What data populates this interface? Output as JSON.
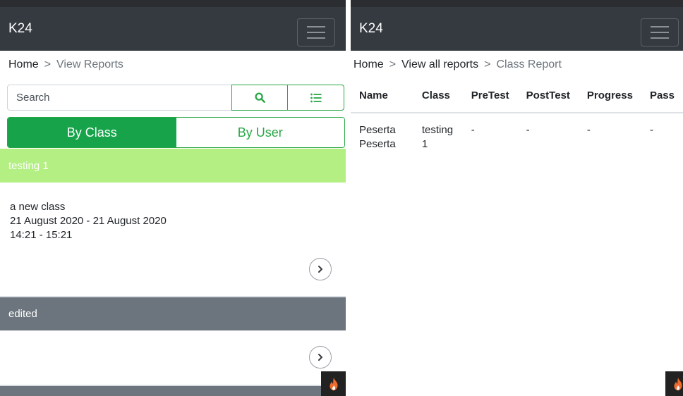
{
  "left": {
    "brand": "K24",
    "breadcrumb": {
      "home": "Home",
      "separator": ">",
      "current": "View Reports"
    },
    "search": {
      "placeholder": "Search"
    },
    "tabs": {
      "by_class": "By Class",
      "by_user": "By User"
    },
    "classes": [
      {
        "title": "testing 1",
        "style": "green",
        "lines": []
      },
      {
        "title": "a new class",
        "style": "none",
        "lines": [
          "a new class",
          "21 August 2020 - 21 August 2020",
          "14:21 - 15:21"
        ]
      },
      {
        "title": "edited",
        "style": "gray",
        "lines": []
      }
    ],
    "colors": {
      "accent": "#28a745",
      "active_tab": "#16a34a",
      "header_green": "#b3ef82",
      "header_gray": "#6c757d"
    }
  },
  "right": {
    "brand": "K24",
    "breadcrumb": {
      "home": "Home",
      "separator": ">",
      "middle": "View all reports",
      "current": "Class Report"
    },
    "table": {
      "headers": [
        "Name",
        "Class",
        "PreTest",
        "PostTest",
        "Progress",
        "Pass"
      ],
      "rows": [
        [
          "Peserta Peserta",
          "testing 1",
          "-",
          "-",
          "-",
          "-"
        ]
      ]
    }
  },
  "icons": {
    "menu": "hamburger-icon",
    "search": "search-icon",
    "list": "list-icon",
    "next": "chevron-right-icon",
    "badge": "fire-icon"
  }
}
